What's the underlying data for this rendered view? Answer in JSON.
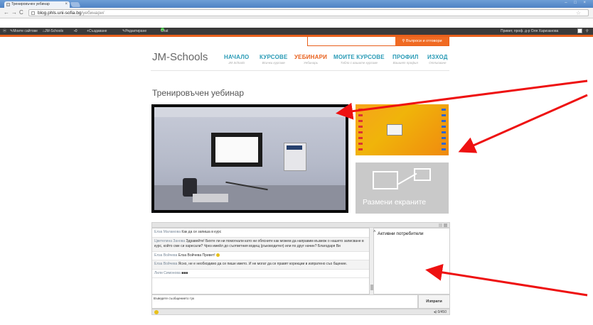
{
  "browser": {
    "tab_title": "Тренировъчен уебинар",
    "tab_close": "×",
    "url_domain": "blog.phls.uni-sofia.bg",
    "url_path": "/уебинари/",
    "window_controls": "– □ ×"
  },
  "adminbar": {
    "my_sites": "Моите сайтове",
    "site_name": "JM-Schools",
    "comments_count": "0",
    "new": "Създаване",
    "edit": "Редактиране",
    "chat": "Chat",
    "greeting": "Привет, проф. д-р Оля Харизанова"
  },
  "search": {
    "button": "Въпроси и отговори"
  },
  "site": {
    "logo": "JM-Schools",
    "menu": [
      {
        "label": "НАЧАЛО",
        "sub": "JM Schools"
      },
      {
        "label": "КУРСОВЕ",
        "sub": "Всички курсове"
      },
      {
        "label": "УЕБИНАРИ",
        "sub": "Уебинарь"
      },
      {
        "label": "МОИТЕ КУРСОВЕ",
        "sub": "Табло с вашите курсове"
      },
      {
        "label": "ПРОФИЛ",
        "sub": "Вашият профил"
      },
      {
        "label": "ИЗХОД",
        "sub": "Отписване"
      }
    ],
    "active_menu": "УЕБИНАРИ",
    "page_title": "Тренировъчен уебинар"
  },
  "swap_screens": "Размени екраните",
  "chat": {
    "messages": [
      {
        "name": "Елза Маламова",
        "text": "Как да се запиша в курс"
      },
      {
        "name": "Цветелина Занова",
        "text": "Здравейте! Бихте ли ни помогнали като ни обясните как можем да направим възмож о нашето записване в курс, който сме си харесали? Чрез имейл до съответния водещ (ръководител) или по друг начин? Благодаря Ви"
      },
      {
        "name": "Елза Войчева",
        "text": "Елза Войчева Привет!"
      },
      {
        "name": "Елза Войчева",
        "text": "Ясно, не е необходимо да се пише името. И не могат да се правят корекции в изпратено съо бщение."
      },
      {
        "name": "Лили Симонова",
        "text": "■■■"
      }
    ],
    "active_users_label": "Активни потребители",
    "input_placeholder": "Въведете съобщението тук",
    "send_button": "Изпрати",
    "char_count": "0/450"
  },
  "colors": {
    "accent_orange": "#e8601c",
    "menu_blue": "#2a9bb6",
    "annotation_red": "#ee1111"
  }
}
